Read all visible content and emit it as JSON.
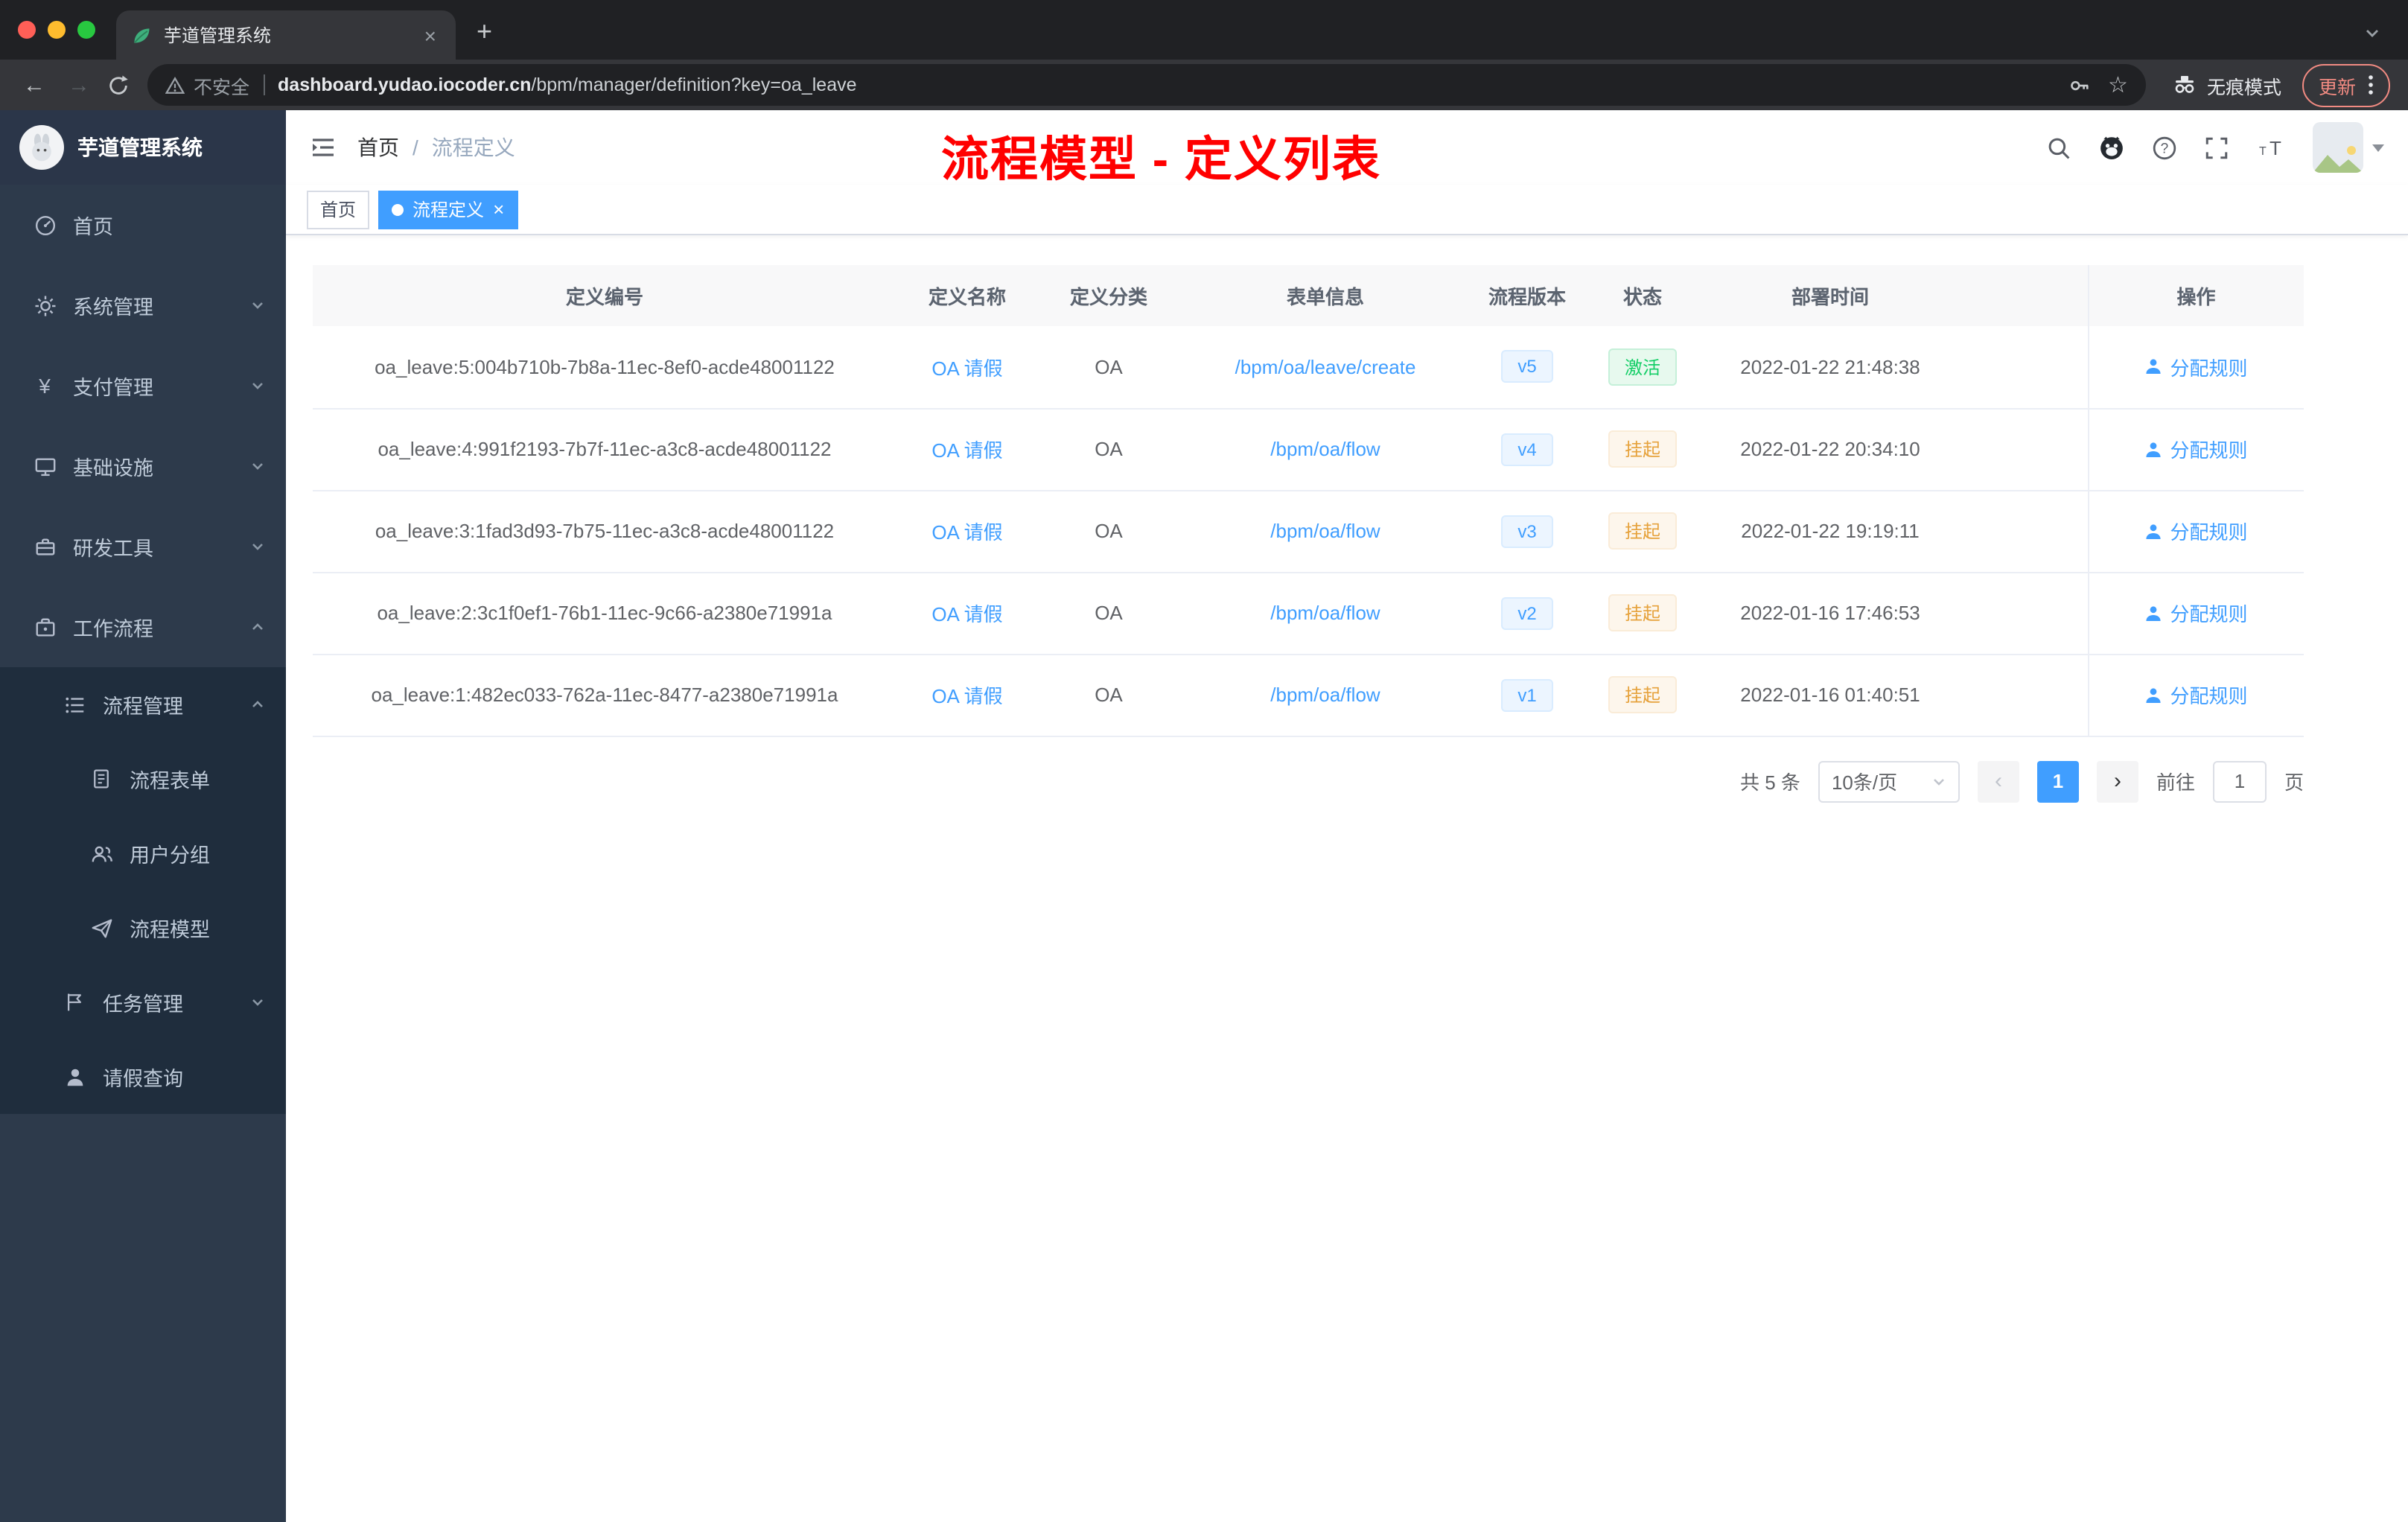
{
  "browser": {
    "tab_title": "芋道管理系统",
    "security_label": "不安全",
    "url_domain": "dashboard.yudao.iocoder.cn",
    "url_path": "/bpm/manager/definition?key=oa_leave",
    "incognito_label": "无痕模式",
    "update_label": "更新"
  },
  "icons": {
    "close": "×",
    "new_tab": "+",
    "back": "←",
    "forward": "→",
    "star": "☆",
    "yen": "¥",
    "breadcrumb_separator": "/",
    "pager_prev": "‹",
    "pager_next": "›"
  },
  "sidebar": {
    "brand": "芋道管理系统",
    "items": {
      "home": "首页",
      "system": "系统管理",
      "payment": "支付管理",
      "infra": "基础设施",
      "devtools": "研发工具",
      "workflow": "工作流程",
      "process_mgmt": "流程管理",
      "process_form": "流程表单",
      "user_group": "用户分组",
      "process_model": "流程模型",
      "task_mgmt": "任务管理",
      "leave_query": "请假查询"
    }
  },
  "navbar": {
    "breadcrumb_home": "首页",
    "breadcrumb_current": "流程定义"
  },
  "annotation": {
    "text": "流程模型 - 定义列表",
    "color": "#FF0000"
  },
  "tags": {
    "home": "首页",
    "current": "流程定义"
  },
  "table": {
    "columns": {
      "id": "定义编号",
      "name": "定义名称",
      "category": "定义分类",
      "form": "表单信息",
      "version": "流程版本",
      "status": "状态",
      "deploy_time": "部署时间",
      "actions": "操作"
    },
    "rows": [
      {
        "id": "oa_leave:5:004b710b-7b8a-11ec-8ef0-acde48001122",
        "name": "OA 请假",
        "category": "OA",
        "form": "/bpm/oa/leave/create",
        "version": "v5",
        "status": "激活",
        "time": "2022-01-22 21:48:38",
        "action": "分配规则"
      },
      {
        "id": "oa_leave:4:991f2193-7b7f-11ec-a3c8-acde48001122",
        "name": "OA 请假",
        "category": "OA",
        "form": "/bpm/oa/flow",
        "version": "v4",
        "status": "挂起",
        "time": "2022-01-22 20:34:10",
        "action": "分配规则"
      },
      {
        "id": "oa_leave:3:1fad3d93-7b75-11ec-a3c8-acde48001122",
        "name": "OA 请假",
        "category": "OA",
        "form": "/bpm/oa/flow",
        "version": "v3",
        "status": "挂起",
        "time": "2022-01-22 19:19:11",
        "action": "分配规则"
      },
      {
        "id": "oa_leave:2:3c1f0ef1-76b1-11ec-9c66-a2380e71991a",
        "name": "OA 请假",
        "category": "OA",
        "form": "/bpm/oa/flow",
        "version": "v2",
        "status": "挂起",
        "time": "2022-01-16 17:46:53",
        "action": "分配规则"
      },
      {
        "id": "oa_leave:1:482ec033-762a-11ec-8477-a2380e71991a",
        "name": "OA 请假",
        "category": "OA",
        "form": "/bpm/oa/flow",
        "version": "v1",
        "status": "挂起",
        "time": "2022-01-16 01:40:51",
        "action": "分配规则"
      }
    ]
  },
  "pagination": {
    "total": "共 5 条",
    "page_size": "10条/页",
    "current_page": "1",
    "goto_label": "前往",
    "goto_value": "1",
    "goto_unit": "页"
  },
  "colors": {
    "accent": "#409EFF",
    "status_active": "#13CE66",
    "status_suspended": "#E6A23C",
    "annotation": "#FF0000"
  }
}
